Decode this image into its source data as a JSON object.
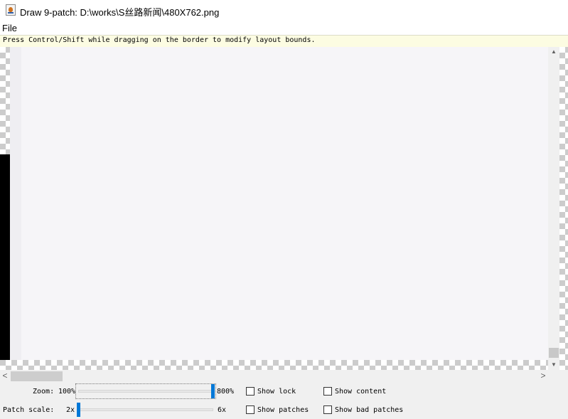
{
  "window": {
    "title": "Draw 9-patch: D:\\works\\S丝路新闻\\480X762.png",
    "icon": "java-coffee-icon"
  },
  "menu": {
    "file": "File"
  },
  "help": {
    "text": "Press Control/Shift while dragging on the border to modify layout bounds."
  },
  "scroll": {
    "up": "▲",
    "down": "▼",
    "left": "<",
    "right": ">"
  },
  "controls": {
    "zoom": {
      "label": "Zoom:",
      "value": "100%",
      "max_label": "800%",
      "level": 1.0
    },
    "patch_scale": {
      "label": "Patch scale:",
      "min_label": "2x",
      "max_label": "6x",
      "level": 0.0
    },
    "checkboxes": {
      "show_lock": {
        "label": "Show lock",
        "checked": false
      },
      "show_content": {
        "label": "Show content",
        "checked": false
      },
      "show_patches": {
        "label": "Show patches",
        "checked": false
      },
      "show_bad_patches": {
        "label": "Show bad patches",
        "checked": false
      }
    }
  },
  "colors": {
    "accent": "#0078d7",
    "help_bg": "#fcfce2",
    "patch_marker": "#000000"
  }
}
